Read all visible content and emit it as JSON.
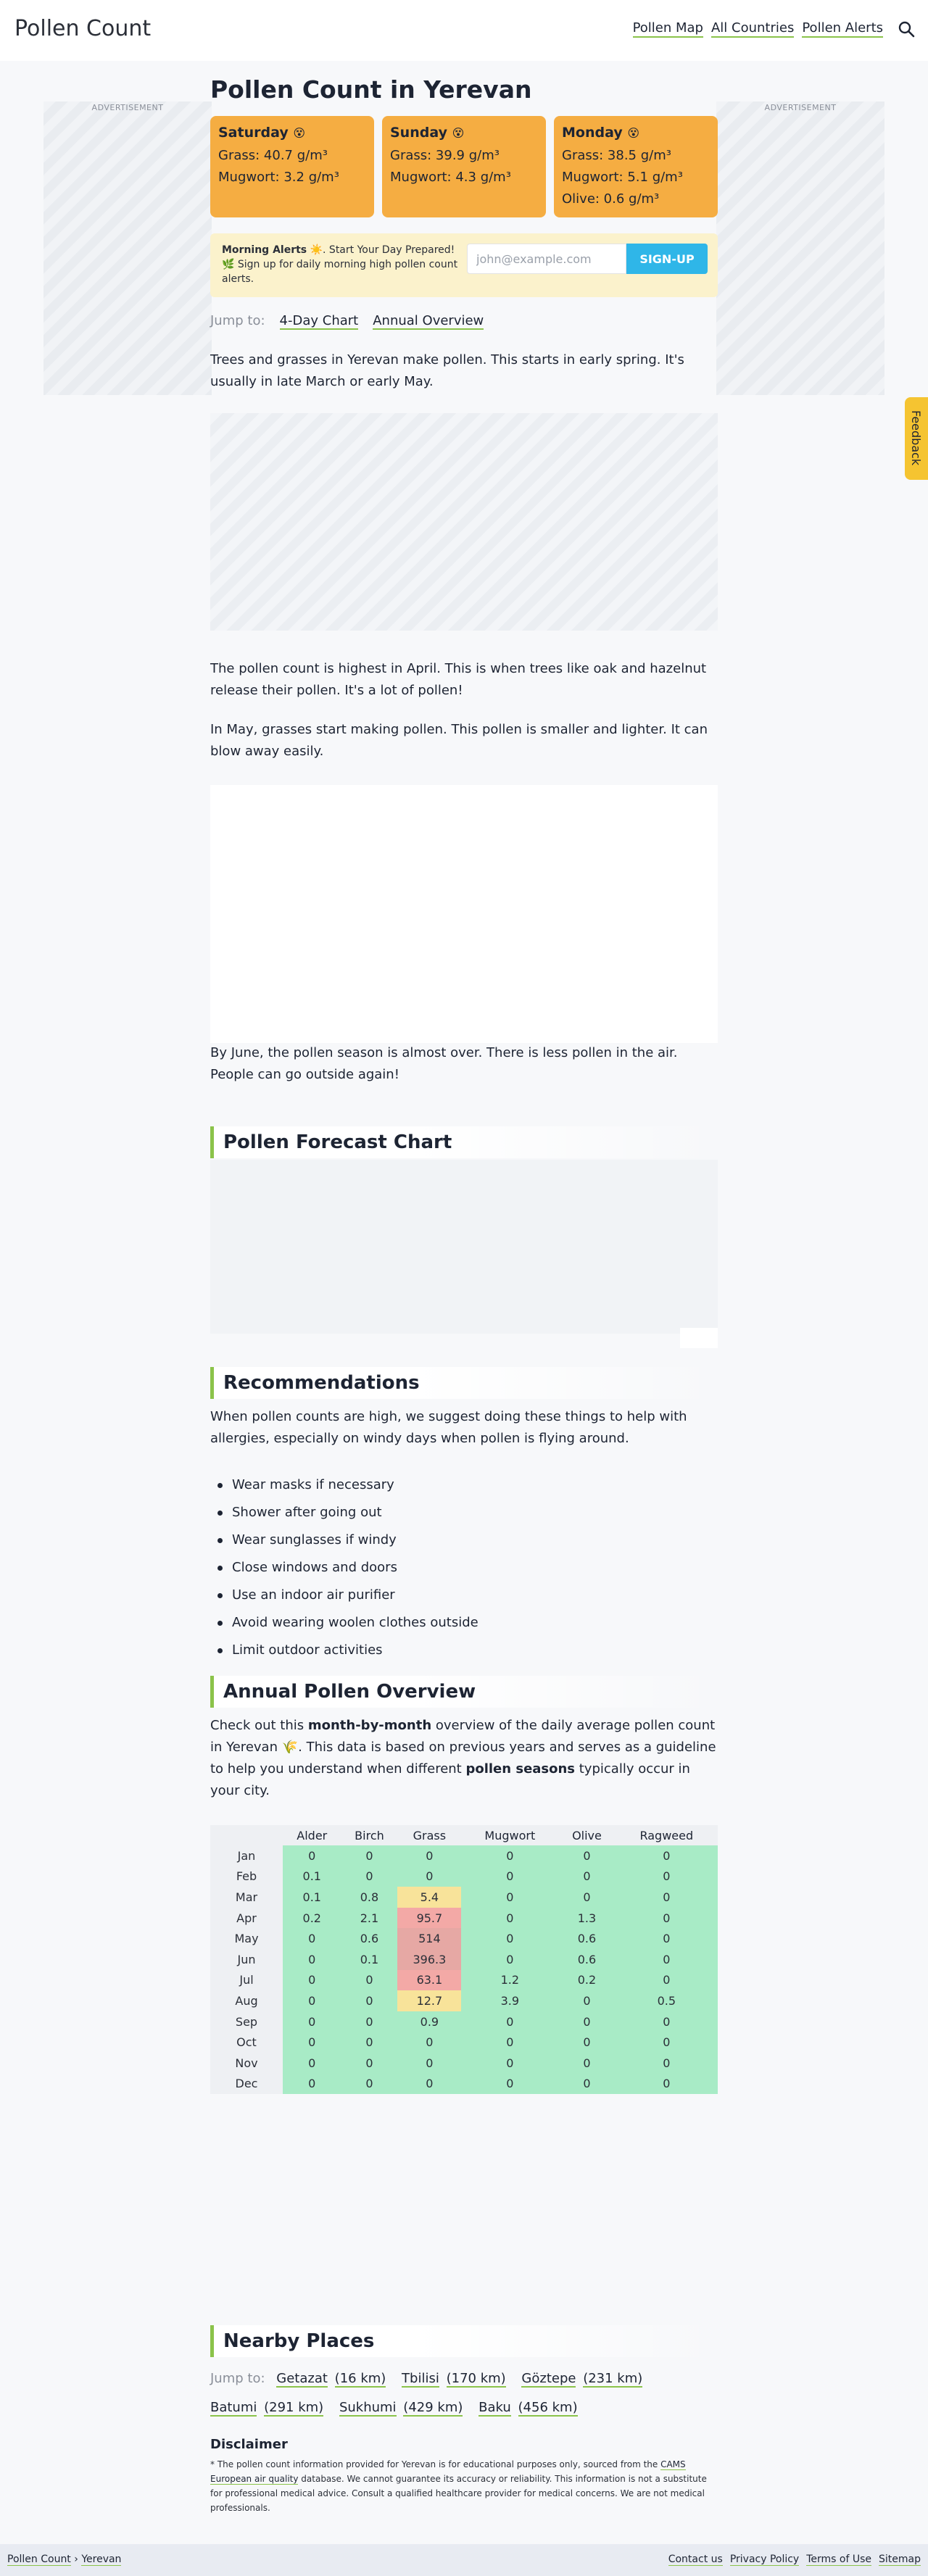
{
  "header": {
    "site_title": "Pollen Count",
    "nav": [
      "Pollen Map",
      "All Countries",
      "Pollen Alerts"
    ],
    "search_icon": "search-icon"
  },
  "ads": {
    "label": "ADVERTISEMENT"
  },
  "page_title": "Pollen Count in Yerevan",
  "forecast_days": [
    {
      "name": "Saturday",
      "emoji": "😵",
      "lines": [
        "Grass: 40.7 g/m³",
        "Mugwort: 3.2 g/m³"
      ]
    },
    {
      "name": "Sunday",
      "emoji": "😵",
      "lines": [
        "Grass: 39.9 g/m³",
        "Mugwort: 4.3 g/m³"
      ]
    },
    {
      "name": "Monday",
      "emoji": "😵",
      "lines": [
        "Grass: 38.5 g/m³",
        "Mugwort: 5.1 g/m³",
        "Olive: 0.6 g/m³"
      ]
    }
  ],
  "alert": {
    "title": "Morning Alerts",
    "sun_emoji": "☀️",
    "text1": ". Start Your Day Prepared!",
    "plant_emoji": "🌿",
    "text2": " Sign up for daily morning high pollen count alerts.",
    "email_placeholder": "john@example.com",
    "button_label": "SIGN-UP"
  },
  "jump": {
    "label": "Jump to:",
    "links": [
      "4-Day Chart",
      "Annual Overview"
    ]
  },
  "paragraphs": {
    "intro": "Trees and grasses in Yerevan make pollen. This starts in early spring. It's usually in late March or early May.",
    "april": "The pollen count is highest in April. This is when trees like oak and hazelnut release their pollen. It's a lot of pollen!",
    "may": "In May, grasses start making pollen. This pollen is smaller and lighter. It can blow away easily.",
    "june": "By June, the pollen season is almost over. There is less pollen in the air. People can go outside again!"
  },
  "sections": {
    "forecast_chart": "Pollen Forecast Chart",
    "recommendations": "Recommendations",
    "annual": "Annual Pollen Overview",
    "nearby": "Nearby Places"
  },
  "recommendations": {
    "intro": "When pollen counts are high, we suggest doing these things to help with allergies, especially on windy days when pollen is flying around.",
    "items": [
      "Wear masks if necessary",
      "Shower after going out",
      "Wear sunglasses if windy",
      "Close windows and doors",
      "Use an indoor air purifier",
      "Avoid wearing woolen clothes outside",
      "Limit outdoor activities"
    ]
  },
  "annual": {
    "intro_a": "Check out this ",
    "intro_bold1": "month-by-month",
    "intro_b": " overview of the daily average pollen count in Yerevan ",
    "intro_emoji": "🌾",
    "intro_c": ". This data is based on previous years and serves as a guideline to help you understand when different ",
    "intro_bold2": "pollen seasons",
    "intro_d": " typically occur in your city.",
    "columns": [
      "Alder",
      "Birch",
      "Grass",
      "Mugwort",
      "Olive",
      "Ragweed"
    ],
    "rows": [
      {
        "month": "Jan",
        "values": [
          "0",
          "0",
          "0",
          "0",
          "0",
          "0"
        ]
      },
      {
        "month": "Feb",
        "values": [
          "0.1",
          "0",
          "0",
          "0",
          "0",
          "0"
        ]
      },
      {
        "month": "Mar",
        "values": [
          "0.1",
          "0.8",
          "5.4",
          "0",
          "0",
          "0"
        ]
      },
      {
        "month": "Apr",
        "values": [
          "0.2",
          "2.1",
          "95.7",
          "0",
          "1.3",
          "0"
        ]
      },
      {
        "month": "May",
        "values": [
          "0",
          "0.6",
          "514",
          "0",
          "0.6",
          "0"
        ]
      },
      {
        "month": "Jun",
        "values": [
          "0",
          "0.1",
          "396.3",
          "0",
          "0.6",
          "0"
        ]
      },
      {
        "month": "Jul",
        "values": [
          "0",
          "0",
          "63.1",
          "1.2",
          "0.2",
          "0"
        ]
      },
      {
        "month": "Aug",
        "values": [
          "0",
          "0",
          "12.7",
          "3.9",
          "0",
          "0.5"
        ]
      },
      {
        "month": "Sep",
        "values": [
          "0",
          "0",
          "0.9",
          "0",
          "0",
          "0"
        ]
      },
      {
        "month": "Oct",
        "values": [
          "0",
          "0",
          "0",
          "0",
          "0",
          "0"
        ]
      },
      {
        "month": "Nov",
        "values": [
          "0",
          "0",
          "0",
          "0",
          "0",
          "0"
        ]
      },
      {
        "month": "Dec",
        "values": [
          "0",
          "0",
          "0",
          "0",
          "0",
          "0"
        ]
      }
    ],
    "level_colors": {
      "low": "#a8ebc6",
      "moderate": "#f8e39a",
      "high": "#f3a9a6",
      "very_high": "#e6a8a4"
    }
  },
  "nearby": {
    "label": "Jump to:",
    "places": [
      {
        "name": "Getazat",
        "dist": "(16 km)"
      },
      {
        "name": "Tbilisi",
        "dist": "(170 km)"
      },
      {
        "name": "Göztepe",
        "dist": "(231 km)"
      },
      {
        "name": "Batumi",
        "dist": "(291 km)"
      },
      {
        "name": "Sukhumi",
        "dist": "(429 km)"
      },
      {
        "name": "Baku",
        "dist": "(456 km)"
      }
    ]
  },
  "disclaimer": {
    "title": "Disclaimer",
    "text_a": "* The pollen count information provided for Yerevan is for educational purposes only, sourced from the ",
    "link": "CAMS European air quality",
    "text_b": " database. We cannot guarantee its accuracy or reliability. This information is not a substitute for professional medical advice. Consult a qualified healthcare provider for medical concerns. We are not medical professionals."
  },
  "footer": {
    "breadcrumb": [
      "Pollen Count",
      "Yerevan"
    ],
    "separator": "›",
    "links": [
      "Contact us",
      "Privacy Policy",
      "Terms of Use",
      "Sitemap"
    ]
  },
  "feedback_label": "Feedback",
  "colors": {
    "accent_green": "#8bc34a",
    "card_orange": "#f5ad42",
    "signup_blue": "#2fb6e8",
    "feedback_yellow": "#f5c431"
  }
}
